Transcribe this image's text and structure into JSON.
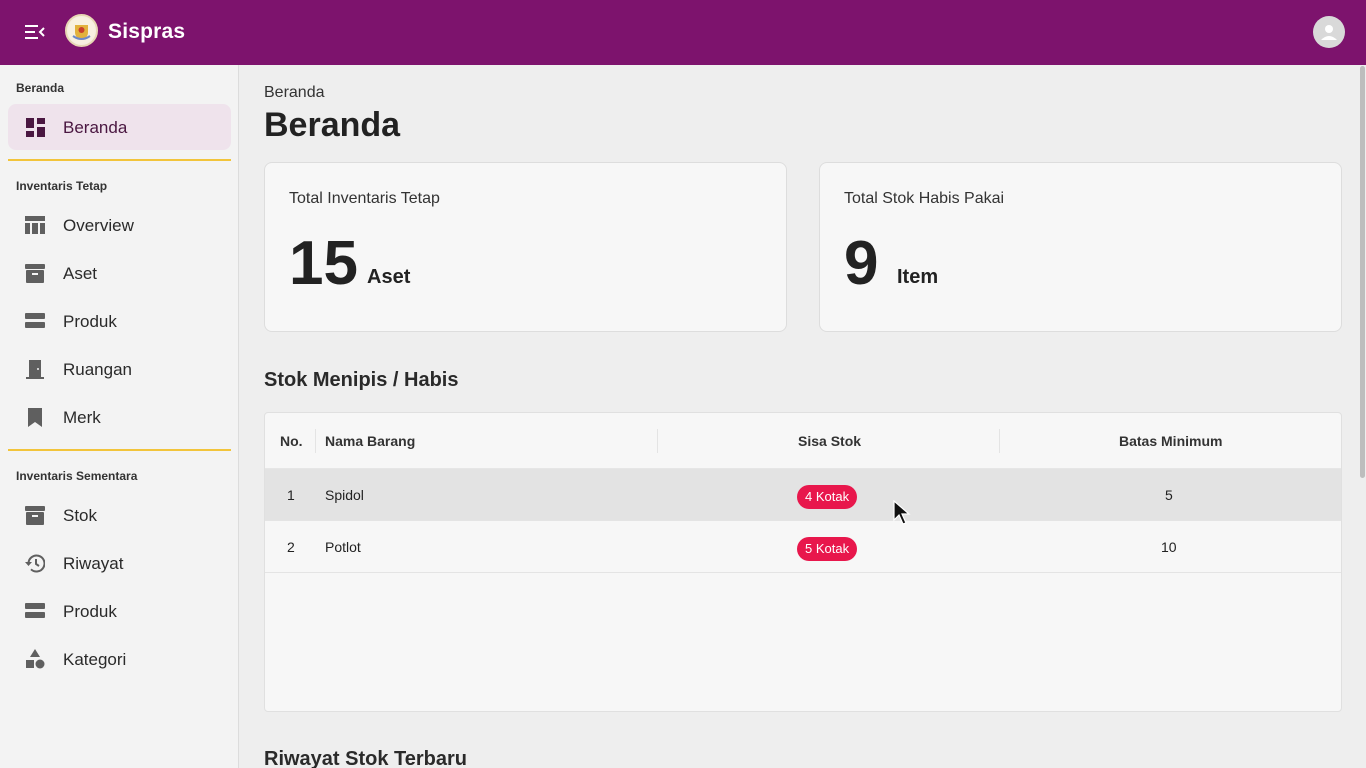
{
  "app": {
    "name": "Sispras"
  },
  "sidebar": {
    "sections": [
      {
        "title": "Beranda",
        "items": [
          {
            "label": "Beranda",
            "icon": "dashboard-icon",
            "active": true
          }
        ]
      },
      {
        "title": "Inventaris Tetap",
        "items": [
          {
            "label": "Overview",
            "icon": "table-icon"
          },
          {
            "label": "Aset",
            "icon": "archive-icon"
          },
          {
            "label": "Produk",
            "icon": "storage-icon"
          },
          {
            "label": "Ruangan",
            "icon": "door-icon"
          },
          {
            "label": "Merk",
            "icon": "bookmark-icon"
          }
        ]
      },
      {
        "title": "Inventaris Sementara",
        "items": [
          {
            "label": "Stok",
            "icon": "archive-icon"
          },
          {
            "label": "Riwayat",
            "icon": "history-icon"
          },
          {
            "label": "Produk",
            "icon": "storage-icon"
          },
          {
            "label": "Kategori",
            "icon": "category-icon"
          }
        ]
      }
    ]
  },
  "main": {
    "breadcrumb": "Beranda",
    "title": "Beranda",
    "cards": [
      {
        "title": "Total Inventaris Tetap",
        "value": "15",
        "unit": "Aset"
      },
      {
        "title": "Total Stok Habis Pakai",
        "value": "9",
        "unit": "Item"
      }
    ],
    "low_stock": {
      "heading": "Stok Menipis / Habis",
      "columns": [
        "No.",
        "Nama Barang",
        "Sisa Stok",
        "Batas Minimum"
      ],
      "rows": [
        {
          "no": "1",
          "name": "Spidol",
          "stock": "4 Kotak",
          "min": "5"
        },
        {
          "no": "2",
          "name": "Potlot",
          "stock": "5 Kotak",
          "min": "10"
        }
      ]
    },
    "history_heading": "Riwayat Stok Terbaru"
  },
  "colors": {
    "topbar": "#7d136d",
    "accent_divider": "#f2c43a",
    "chip": "#e8174c",
    "active_bg": "#efe3ec"
  }
}
